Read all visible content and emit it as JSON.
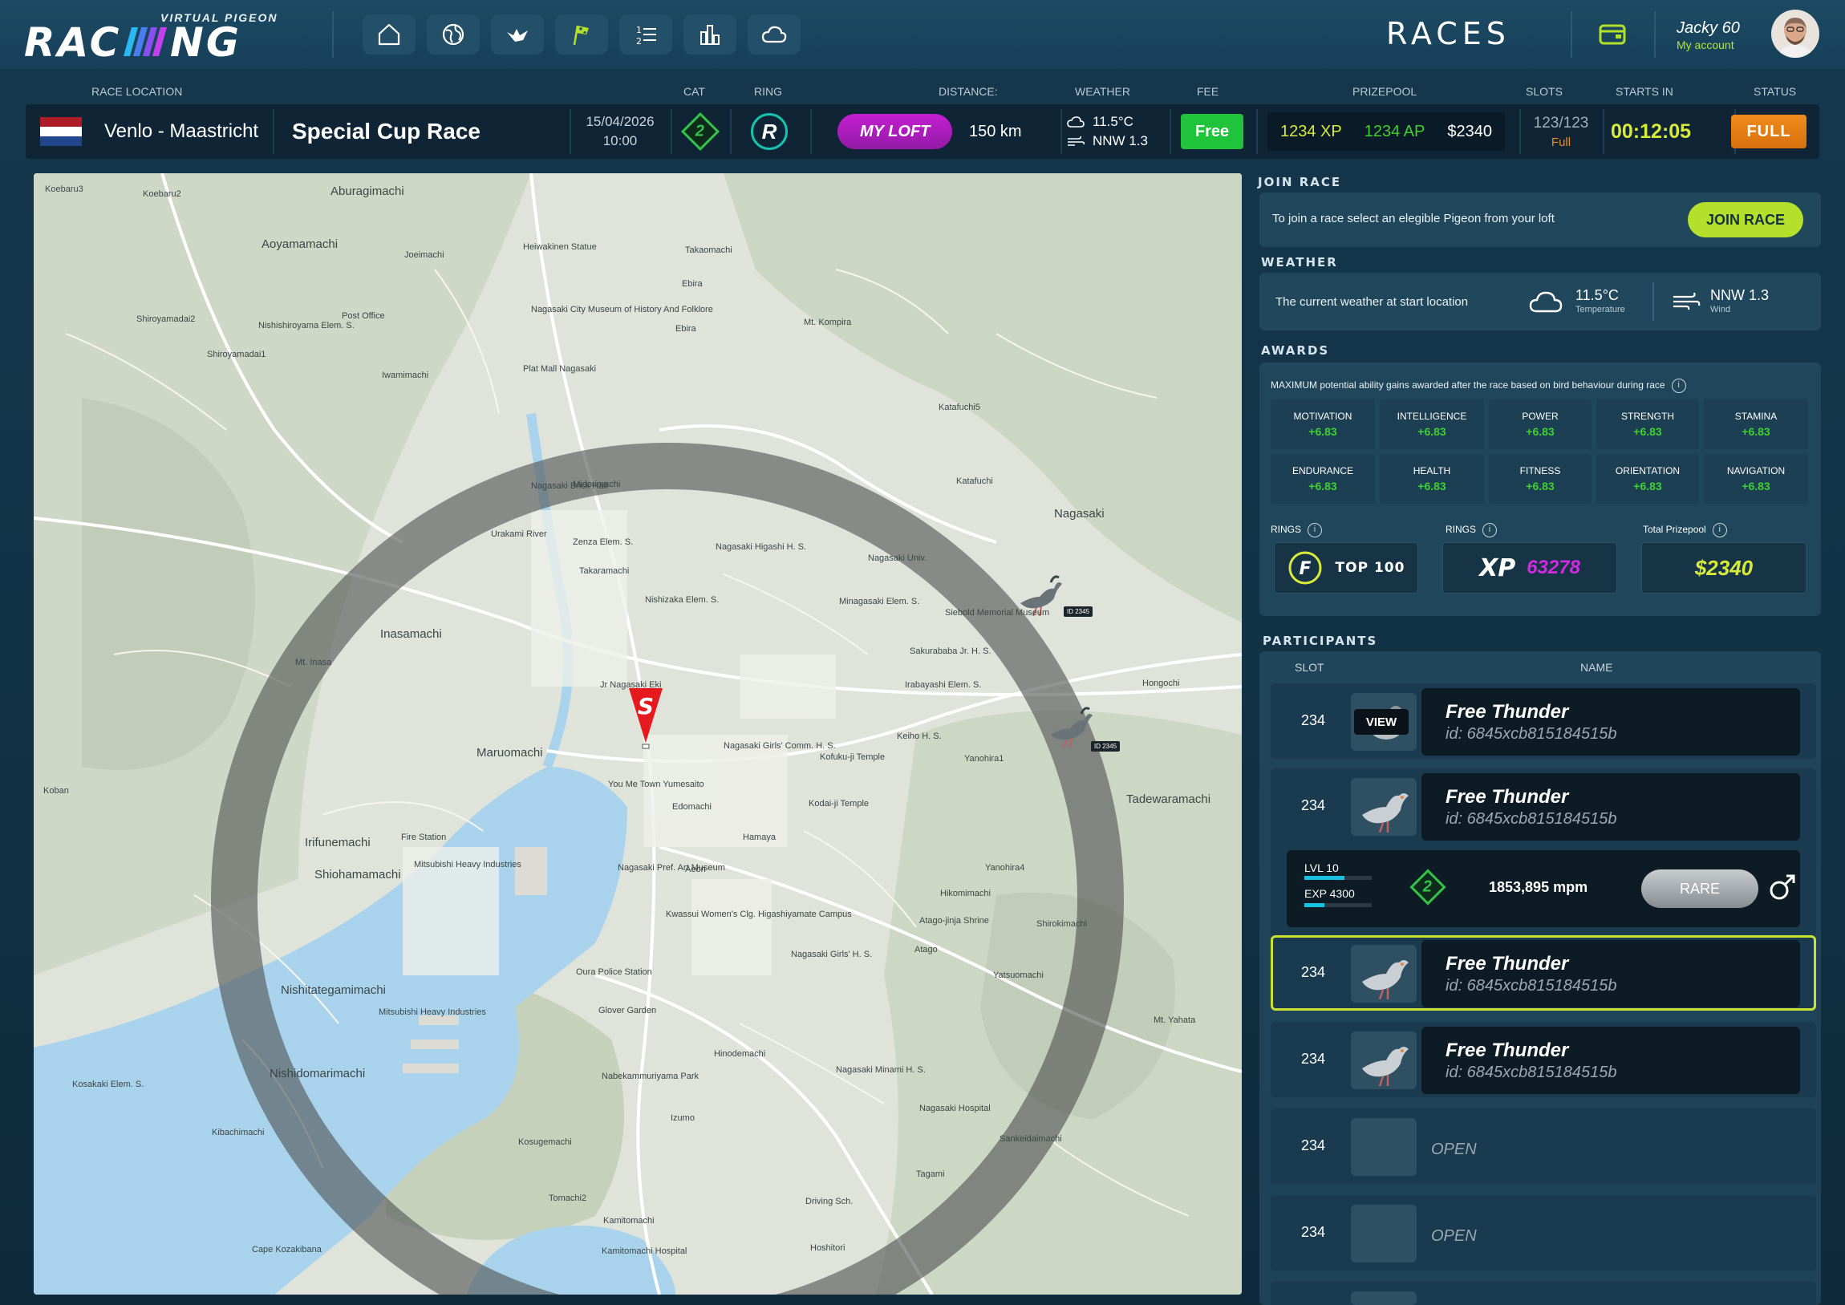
{
  "app": {
    "logo_sub": "VIRTUAL PIGEON",
    "logo_main": "RACING",
    "page_title": "RACES"
  },
  "user": {
    "name": "Jacky 60",
    "account_link": "My account"
  },
  "nav_icons": [
    "home-icon",
    "globe-icon",
    "pigeon-icon",
    "race-flags-icon",
    "ranking-list-icon",
    "stats-chart-icon",
    "weather-cloud-icon"
  ],
  "race": {
    "labels": {
      "location": "RACE LOCATION",
      "cat": "CAT",
      "ring": "RING",
      "distance": "DISTANCE:",
      "weather": "WEATHER",
      "fee": "FEE",
      "prizepool": "PRIZEPOOL",
      "slots": "SLOTS",
      "starts_in": "STARTS IN",
      "status": "STATUS"
    },
    "location": "Venlo - Maastricht",
    "name": "Special Cup Race",
    "date": "15/04/2026",
    "time": "10:00",
    "cat": "2",
    "ring": "R",
    "my_loft": "MY LOFT",
    "distance": "150 km",
    "temperature": "11.5°C",
    "wind": "NNW 1.3",
    "fee": "Free",
    "prize_xp": "1234 XP",
    "prize_ap": "1234 AP",
    "prize_money": "$2340",
    "slots": "123/123",
    "slots_status": "Full",
    "countdown": "00:12:05",
    "status": "FULL"
  },
  "join_race": {
    "title": "JOIN RACE",
    "text": "To join a race select an elegible Pigeon from your loft",
    "button": "JOIN RACE"
  },
  "weather": {
    "title": "WEATHER",
    "text": "The current weather at start location",
    "temperature": "11.5°C",
    "temperature_label": "Temperature",
    "wind": "NNW 1.3",
    "wind_label": "Wind"
  },
  "awards": {
    "title": "AWARDS",
    "text": "MAXIMUM potential ability gains awarded after the race based on bird behaviour during race",
    "items": [
      {
        "name": "MOTIVATION",
        "value": "+6.83"
      },
      {
        "name": "INTELLIGENCE",
        "value": "+6.83"
      },
      {
        "name": "POWER",
        "value": "+6.83"
      },
      {
        "name": "STRENGTH",
        "value": "+6.83"
      },
      {
        "name": "STAMINA",
        "value": "+6.83"
      },
      {
        "name": "ENDURANCE",
        "value": "+6.83"
      },
      {
        "name": "HEALTH",
        "value": "+6.83"
      },
      {
        "name": "FITNESS",
        "value": "+6.83"
      },
      {
        "name": "ORIENTATION",
        "value": "+6.83"
      },
      {
        "name": "NAVIGATION",
        "value": "+6.83"
      }
    ],
    "rings_label_1": "RINGS",
    "rings_label_2": "RINGS",
    "prizepool_label": "Total Prizepool",
    "top_badge": "TOP 100",
    "xp_label": "XP",
    "xp_value": "63278",
    "prizepool_value": "$2340"
  },
  "participants": {
    "title": "PARTICIPANTS",
    "col_slot": "SLOT",
    "col_name": "NAME",
    "view_label": "VIEW",
    "rows": [
      {
        "slot": "234",
        "name": "Free Thunder",
        "id": "id: 6845xcb815184515b"
      },
      {
        "slot": "234",
        "name": "Free Thunder",
        "id": "id: 6845xcb815184515b"
      },
      {
        "slot": "234",
        "name": "Free Thunder",
        "id": "id: 6845xcb815184515b"
      },
      {
        "slot": "234",
        "name": "Free Thunder",
        "id": "id: 6845xcb815184515b"
      },
      {
        "slot": "234",
        "open": "OPEN"
      },
      {
        "slot": "234",
        "open": "OPEN"
      }
    ],
    "detail": {
      "level": "LVL 10",
      "exp": "EXP 4300",
      "cat": "2",
      "speed": "1853,895 mpm",
      "rarity": "RARE",
      "level_progress": 0.6,
      "exp_progress": 0.3
    }
  },
  "map": {
    "start_marker": "S",
    "pigeon_tags": [
      "ID 2345",
      "ID 2345"
    ],
    "labels": [
      "Koebaru3",
      "Koebaru2",
      "Aburagimachi",
      "Aoyamamachi",
      "Joeimachi",
      "Heiwakinen Statue",
      "Takaomachi",
      "Ebira",
      "Shiroyamadai2",
      "Nishishiroyama Elem. S.",
      "Post Office",
      "Nagasaki City Museum of History And Folklore",
      "Ebira",
      "Shiroyamadai1",
      "Iwamimachi",
      "Plat Mall Nagasaki",
      "Mt. Kompira",
      "Katafuchi5",
      "Midorimachi",
      "Nagasaki Brick Hall",
      "Katafuchi",
      "Nagasaki",
      "Urakami River",
      "Zenza Elem. S.",
      "Takaramachi",
      "Nagasaki Higashi H. S.",
      "Nagasaki Univ.",
      "Inasamachi",
      "Nishizaka Elem. S.",
      "Minagasaki Elem. S.",
      "Siebold Memorial Museum",
      "Sakurababa Jr. H. S.",
      "Hongochi",
      "Mt. Inasa",
      "Jr Nagasaki Eki",
      "Irabayashi Elem. S.",
      "Nagasaki Girls' Comm. H. S.",
      "Kofuku-ji Temple",
      "Keiho H. S.",
      "Yanohira1",
      "Maruomachi",
      "You Me Town Yumesaito",
      "Edomachi",
      "Kodai-ji Temple",
      "Tadewaramachi",
      "Irifunemachi",
      "Hamaya",
      "Fire Station",
      "Shiohamamachi",
      "Mitsubishi Heavy Industries",
      "Nagasaki Pref. Art Museum",
      "Aeon",
      "Yanohira4",
      "Hikomimachi",
      "Kwassui Women's Clg. Higashiyamate Campus",
      "Atago-jinja Shrine",
      "Shirokimachi",
      "Atago",
      "Oura Police Station",
      "Nagasaki Girls' H. S.",
      "Yatsuomachi",
      "Nishitategamimachi",
      "Mitsubishi Heavy Industries",
      "Glover Garden",
      "Nishidomarimachi",
      "Hinodemachi",
      "Nabekammuriyama Park",
      "Nagasaki Minami H. S.",
      "Mt. Yahata",
      "Kibachimachi",
      "Izumo",
      "Nagasaki Hospital",
      "Kosugemachi",
      "Sankeidaimachi",
      "Tagami",
      "Tomachi2",
      "Driving Sch.",
      "Kamitomachi",
      "Hoshitori",
      "Kamitomachi Hospital",
      "Cape Kozakibana",
      "Koban",
      "Kosakaki Elem. S."
    ]
  },
  "colors": {
    "accent_green": "#b4e02b",
    "stat_green": "#3ed02f",
    "magenta": "#c41ed0",
    "orange": "#f18a1d",
    "teal": "#19c2b0"
  }
}
